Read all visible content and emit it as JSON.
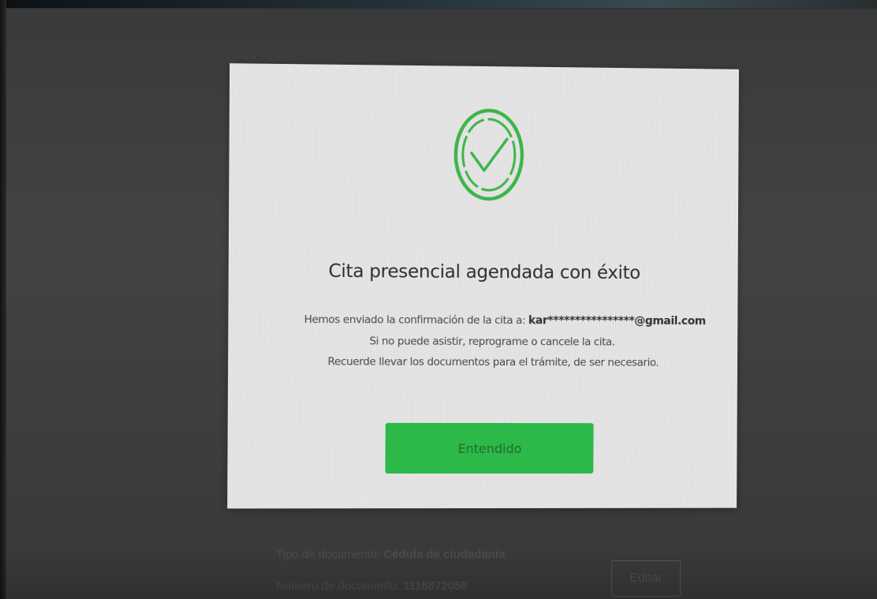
{
  "modal": {
    "icon": "check-circle-icon",
    "title": "Cita presencial agendada con éxito",
    "line1_prefix": "Hemos enviado la confirmación de la cita a: ",
    "email": "kar****************@gmail.com",
    "line2": "Si no puede asistir, reprograme o cancele la cita.",
    "line3": "Recuerde llevar los documentos para el trámite, de ser necesario.",
    "confirm_label": "Entendido"
  },
  "background": {
    "doc_type_label": "Tipo de documento: ",
    "doc_type_value": "Cédula de ciudadanía",
    "doc_number_label": "Número de documento: ",
    "doc_number_value": "1118872058",
    "edit_label": "Editar"
  },
  "colors": {
    "success_green": "#2dbb4a",
    "check_green": "#3cb84b",
    "modal_bg": "#e6e5e5",
    "backdrop": "#3f3f3f"
  }
}
